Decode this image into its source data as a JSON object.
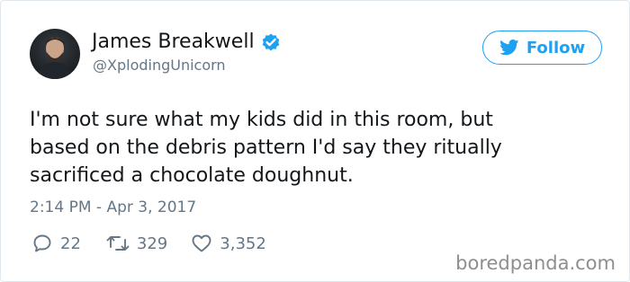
{
  "author": {
    "display_name": "James Breakwell",
    "handle": "@XplodingUnicorn",
    "verified": true
  },
  "follow_button": {
    "label": "Follow"
  },
  "tweet": {
    "lines": [
      "I'm not sure what my kids did in this room, but",
      "based on the debris pattern I'd say they ritually",
      "sacrificed a chocolate doughnut."
    ],
    "timestamp": "2:14 PM - Apr 3, 2017"
  },
  "engagement": {
    "replies": "22",
    "retweets": "329",
    "likes": "3,352"
  },
  "icons": {
    "verified": "verified-badge-icon",
    "follow": "twitter-bird-icon",
    "reply": "reply-icon",
    "retweet": "retweet-icon",
    "like": "heart-icon"
  },
  "colors": {
    "accent": "#1da1f2",
    "text": "#14171a",
    "muted": "#657786",
    "border": "#e1e8ed"
  },
  "watermark": "boredpanda.com"
}
